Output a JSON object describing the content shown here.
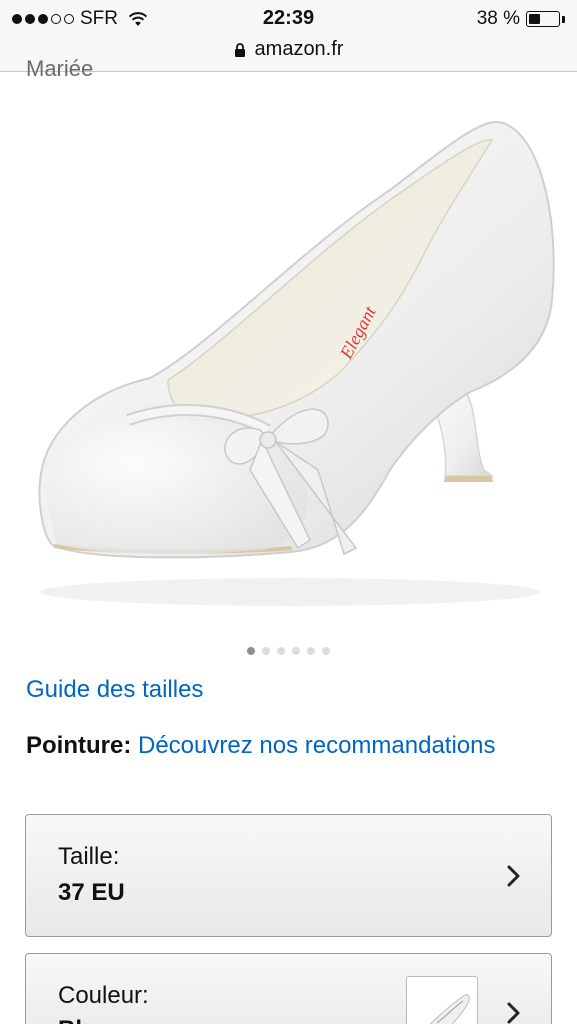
{
  "status_bar": {
    "carrier": "SFR",
    "time": "22:39",
    "battery_percent": "38 %",
    "battery_level": 0.38,
    "signal_bars_filled": 3,
    "signal_bars_total": 5
  },
  "browser": {
    "url": "amazon.fr"
  },
  "product": {
    "title_fragment": "Mariée",
    "image_icon": "white-satin-pump-shoe-image",
    "carousel": {
      "total": 6,
      "active_index": 0
    }
  },
  "size_guide": {
    "label": "Guide des tailles"
  },
  "fit": {
    "label": "Pointure:",
    "link": "Découvrez nos recommandations"
  },
  "size_selector": {
    "label": "Taille:",
    "value": "37 EU"
  },
  "color_selector": {
    "label": "Couleur:",
    "value": "Blanc"
  },
  "colors": {
    "link": "#0066c0",
    "status_bg": "#f7f7f7",
    "selector_border": "#9a9a9a"
  }
}
